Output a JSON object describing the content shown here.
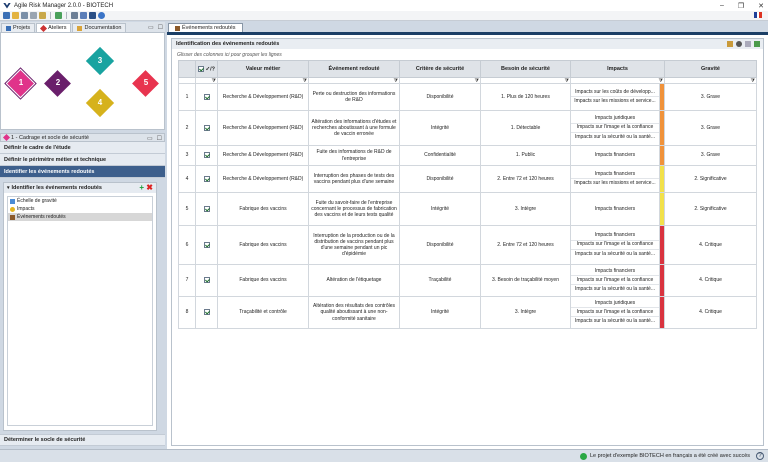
{
  "window": {
    "title": "Agile Risk Manager 2.0.0 - BIOTECH",
    "controls": [
      "–",
      "❐",
      "✕"
    ]
  },
  "left_tabs": [
    {
      "label": "Projets",
      "icon": "folder-icon"
    },
    {
      "label": "Ateliers",
      "icon": "workshops-icon"
    },
    {
      "label": "Documentation",
      "icon": "documentation-icon"
    }
  ],
  "workshops": [
    {
      "num": "1",
      "color": "#e0338a"
    },
    {
      "num": "2",
      "color": "#6a1f6b"
    },
    {
      "num": "3",
      "color": "#18a3a0"
    },
    {
      "num": "4",
      "color": "#d6b21c"
    },
    {
      "num": "5",
      "color": "#e8344f"
    }
  ],
  "workshop_panel": {
    "title": "1 - Cadrage et socle de sécurité"
  },
  "nav_items": [
    {
      "label": "Définir le cadre de l'étude",
      "active": false
    },
    {
      "label": "Définir le périmètre métier et technique",
      "active": false
    },
    {
      "label": "Identifier les événements redoutés",
      "active": true
    }
  ],
  "subpanel": {
    "title": "Identifier les événements redoutés",
    "add": "+",
    "delete": "✖",
    "items": [
      {
        "label": "Échelle de gravité",
        "selected": false
      },
      {
        "label": "Impacts",
        "selected": false
      },
      {
        "label": "Événements redoutés",
        "selected": true
      }
    ]
  },
  "bottom_nav": {
    "label": "Déterminer le socle de sécurité"
  },
  "doc_tab": {
    "label": "Événements redoutés"
  },
  "content": {
    "title": "Identification des événements redoutés",
    "group_hint": "Glisser des colonnes ici pour grouper les lignes"
  },
  "table": {
    "headers": {
      "check": "✓/?",
      "valeur": "Valeur métier",
      "evenement": "Événement redouté",
      "critere": "Critère de sécurité",
      "besoin": "Besoin de sécurité",
      "impacts": "Impacts",
      "gravite": "Gravité"
    },
    "rows": [
      {
        "num": "1",
        "valeur": "Recherche & Développement (R&D)",
        "evenement": "Perte ou destruction des informations de R&D",
        "critere": "Disponibilité",
        "besoin": "1. Plus de 120 heures",
        "impacts": [
          "Impacts sur les coûts de développ...",
          "Impacts sur les missions et service..."
        ],
        "gravite": "3. Grave",
        "color": "#f0923a"
      },
      {
        "num": "2",
        "valeur": "Recherche & Développement (R&D)",
        "evenement": "Altération des informations d'études et recherches aboutissant à une formule de vaccin erronée",
        "critere": "Intégrité",
        "besoin": "1. Détectable",
        "impacts": [
          "Impacts juridiques",
          "Impacts sur l'image et la confiance",
          "Impacts sur la sécurité ou la santé..."
        ],
        "gravite": "3. Grave",
        "color": "#f0923a"
      },
      {
        "num": "3",
        "valeur": "Recherche & Développement (R&D)",
        "evenement": "Fuite des informations de R&D de l'entreprise",
        "critere": "Confidentialité",
        "besoin": "1. Public",
        "impacts": [
          "Impacts financiers"
        ],
        "gravite": "3. Grave",
        "color": "#f0923a"
      },
      {
        "num": "4",
        "valeur": "Recherche & Développement (R&D)",
        "evenement": "Interruption des phases de tests des vaccins pendant plus d'une semaine",
        "critere": "Disponibilité",
        "besoin": "2. Entre 72 et 120 heures",
        "impacts": [
          "Impacts financiers",
          "Impacts sur les missions et service..."
        ],
        "gravite": "2. Significative",
        "color": "#f2e14a"
      },
      {
        "num": "5",
        "valeur": "Fabrique des vaccins",
        "evenement": "Fuite du savoir-faire de l'entreprise concernant le processus de fabrication des vaccins et de leurs tests qualité",
        "critere": "Intégrité",
        "besoin": "3. Intègre",
        "impacts": [
          "Impacts financiers"
        ],
        "gravite": "2. Significative",
        "color": "#f2e14a"
      },
      {
        "num": "6",
        "valeur": "Fabrique des vaccins",
        "evenement": "Interruption de la production ou de la distribution de vaccins pendant plus d'une semaine pendant un pic d'épidémie",
        "critere": "Disponibilité",
        "besoin": "2. Entre 72 et 120 heures",
        "impacts": [
          "Impacts financiers",
          "Impacts sur l'image et la confiance",
          "Impacts sur la sécurité ou la santé..."
        ],
        "gravite": "4. Critique",
        "color": "#d9333f"
      },
      {
        "num": "7",
        "valeur": "Fabrique des vaccins",
        "evenement": "Altération de l'étiquetage",
        "critere": "Traçabilité",
        "besoin": "3. Besoin de traçabilité moyen",
        "impacts": [
          "Impacts financiers",
          "Impacts sur l'image et la confiance",
          "Impacts sur la sécurité ou la santé..."
        ],
        "gravite": "4. Critique",
        "color": "#d9333f"
      },
      {
        "num": "8",
        "valeur": "Traçabilité et contrôle",
        "evenement": "Altération des résultats des contrôles qualité aboutissant à une non-conformité sanitaire",
        "critere": "Intégrité",
        "besoin": "3. Intègre",
        "impacts": [
          "Impacts juridiques",
          "Impacts sur l'image et la confiance",
          "Impacts sur la sécurité ou la santé..."
        ],
        "gravite": "4. Critique",
        "color": "#d9333f"
      }
    ]
  },
  "status": {
    "message": "Le projet d'exemple BIOTECH en français a été créé avec succès",
    "help": "?"
  }
}
